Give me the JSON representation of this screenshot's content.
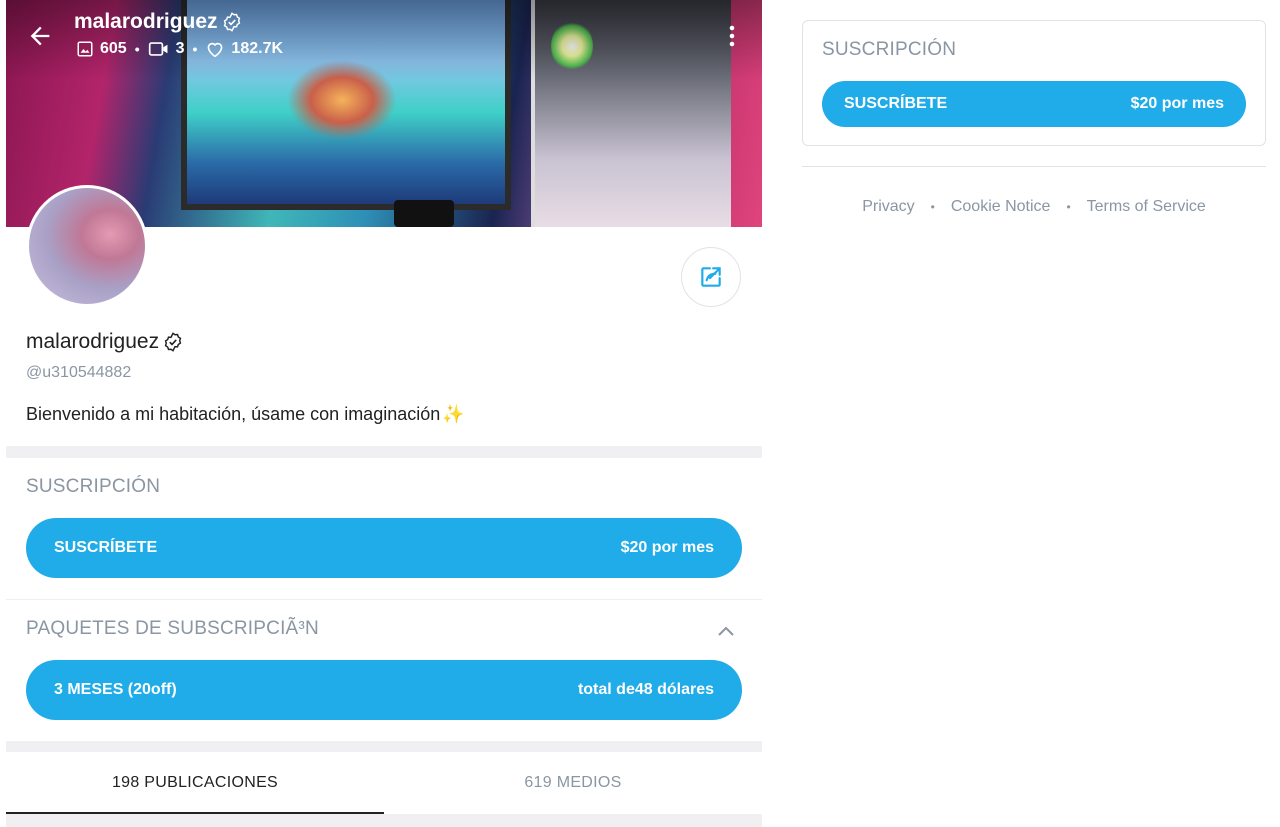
{
  "profile": {
    "name": "malarodriguez",
    "handle": "@u310544882",
    "bio": "Bienvenido a mi habitación, úsame con imaginación",
    "bio_emoji": "✨",
    "stats": {
      "photos": "605",
      "videos": "3",
      "likes": "182.7K"
    }
  },
  "subscription": {
    "title": "SUSCRIPCIÓN",
    "button_label": "SUSCRÍBETE",
    "price": "$20 por mes"
  },
  "bundles": {
    "title": "PAQUETES DE SUBSCRIPCIÃ³N",
    "items": [
      {
        "label": "3 MESES (20off)",
        "price": "total de48 dólares"
      }
    ]
  },
  "tabs": [
    {
      "label": "198 PUBLICACIONES",
      "active": true
    },
    {
      "label": "619 MEDIOS",
      "active": false
    }
  ],
  "sidebar": {
    "subscription_title": "SUSCRIPCIÓN",
    "button_label": "SUSCRÍBETE",
    "price": "$20 por mes"
  },
  "footer": {
    "links": [
      "Privacy",
      "Cookie Notice",
      "Terms of Service"
    ],
    "separator": "•"
  },
  "colors": {
    "accent": "#20abe9",
    "muted": "#8a96a3",
    "text": "#222222"
  },
  "icons": [
    "back-arrow-icon",
    "verified-icon",
    "image-icon",
    "video-icon",
    "heart-icon",
    "more-vertical-icon",
    "share-icon",
    "chevron-up-icon",
    "sparkles-icon"
  ]
}
